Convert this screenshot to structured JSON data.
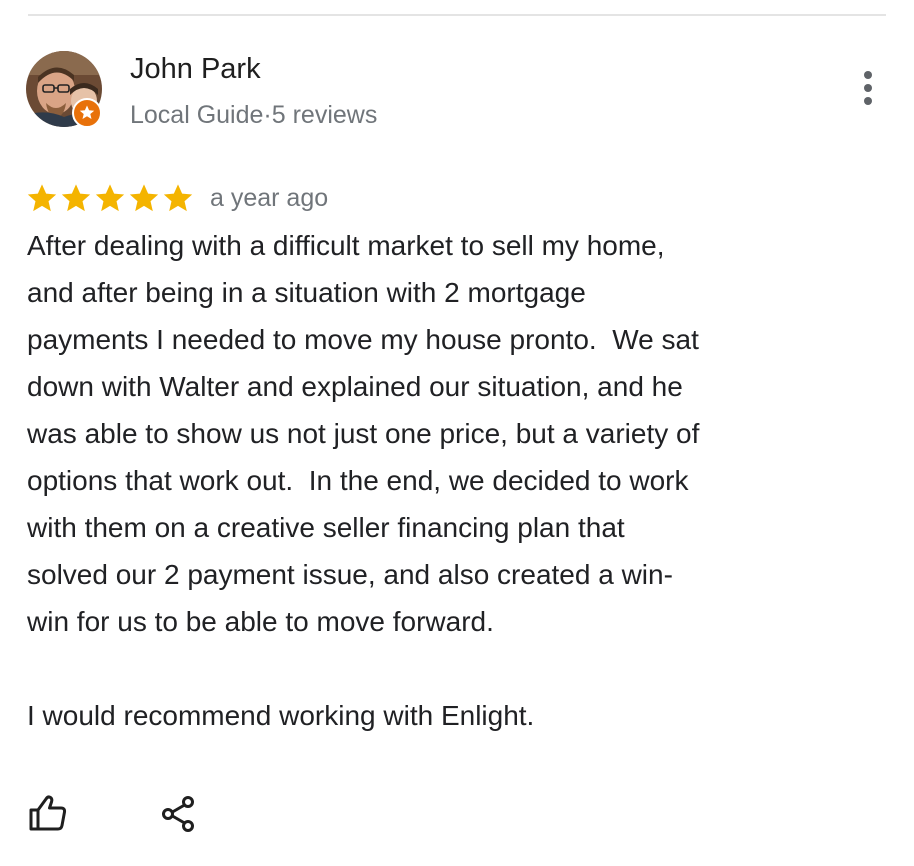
{
  "review": {
    "reviewer_name": "John Park",
    "reviewer_meta": "Local Guide·5 reviews",
    "rating": 5,
    "max_rating": 5,
    "date": "a year ago",
    "text_lines": [
      "After dealing with a difficult market to sell my home,",
      "and after being in a situation with 2 mortgage",
      "payments I needed to move my house pronto.  We sat",
      "down with Walter and explained our situation, and he",
      "was able to show us not just one price, but a variety of",
      "options that work out.  In the end, we decided to work",
      "with them on a creative seller financing plan that",
      "solved our 2 payment issue, and also created a win-",
      "win for us to be able to move forward."
    ],
    "closing_line": "I would recommend working with Enlight."
  },
  "icons": {
    "avatar": "avatar-photo",
    "badge": "local-guide-badge-icon",
    "more": "more-vert-icon",
    "star": "star-icon",
    "like": "thumbs-up-icon",
    "share": "share-icon"
  },
  "colors": {
    "star": "#f4b400",
    "badge": "#e8710a",
    "meta_text": "#70757a",
    "body_text": "#202124"
  }
}
